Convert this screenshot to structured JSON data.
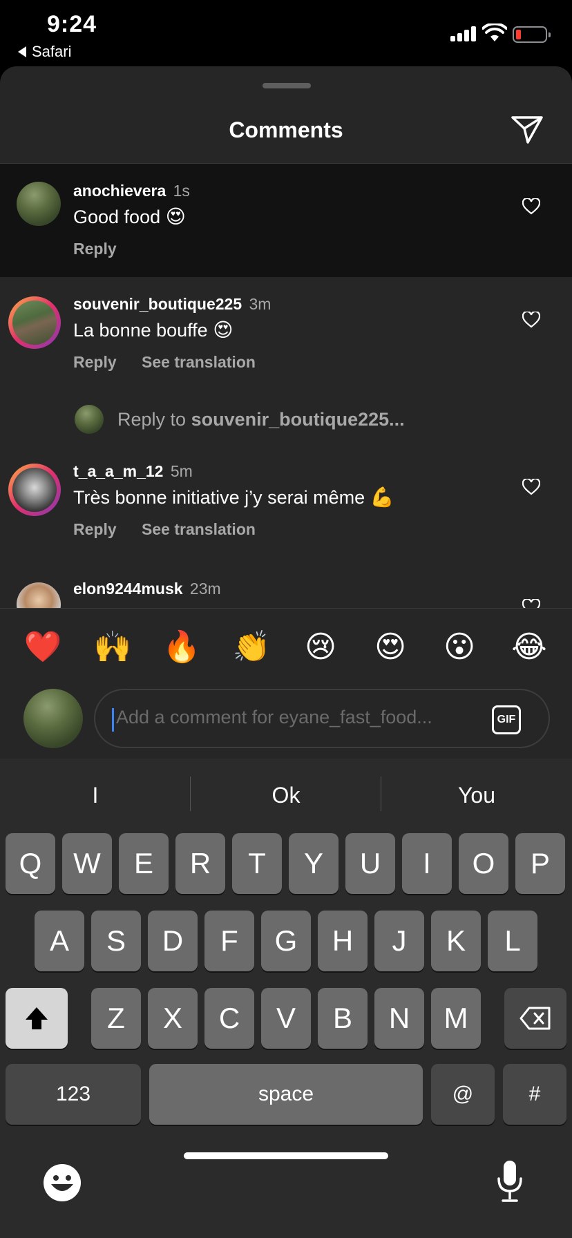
{
  "status_bar": {
    "time": "9:24",
    "back_label": "Safari"
  },
  "sheet": {
    "title": "Comments"
  },
  "comments": [
    {
      "user": "anochievera",
      "time": "1s",
      "text": "Good food",
      "emoji": "😍",
      "actions": [
        "Reply"
      ]
    },
    {
      "user": "souvenir_boutique225",
      "time": "3m",
      "text": "La bonne bouffe",
      "emoji": "😍",
      "actions": [
        "Reply",
        "See translation"
      ]
    },
    {
      "user": "t_a_a_m_12",
      "time": "5m",
      "text": "Très bonne initiative j’y serai même",
      "emoji": "💪",
      "actions": [
        "Reply",
        "See translation"
      ]
    },
    {
      "user": "elon9244musk",
      "time": "23m"
    }
  ],
  "reply_to": {
    "prefix": "Reply to",
    "user": "souvenir_boutique225..."
  },
  "emoji_bar": [
    "❤️",
    "🙌",
    "🔥",
    "👏",
    "😢",
    "😍",
    "😮",
    "😂"
  ],
  "composer": {
    "placeholder": "Add a comment for eyane_fast_food...",
    "gif_label": "GIF"
  },
  "keyboard": {
    "suggestions": [
      "I",
      "Ok",
      "You"
    ],
    "row1": [
      "Q",
      "W",
      "E",
      "R",
      "T",
      "Y",
      "U",
      "I",
      "O",
      "P"
    ],
    "row2": [
      "A",
      "S",
      "D",
      "F",
      "G",
      "H",
      "J",
      "K",
      "L"
    ],
    "row3": [
      "Z",
      "X",
      "C",
      "V",
      "B",
      "N",
      "M"
    ],
    "numbers_label": "123",
    "space_label": "space",
    "at_label": "@",
    "hash_label": "#"
  },
  "icons": [
    "signal-icon",
    "wifi-icon",
    "battery-icon",
    "send-icon",
    "heart-icon",
    "shift-icon",
    "backspace-icon",
    "emoji-keyboard-icon",
    "microphone-icon"
  ]
}
